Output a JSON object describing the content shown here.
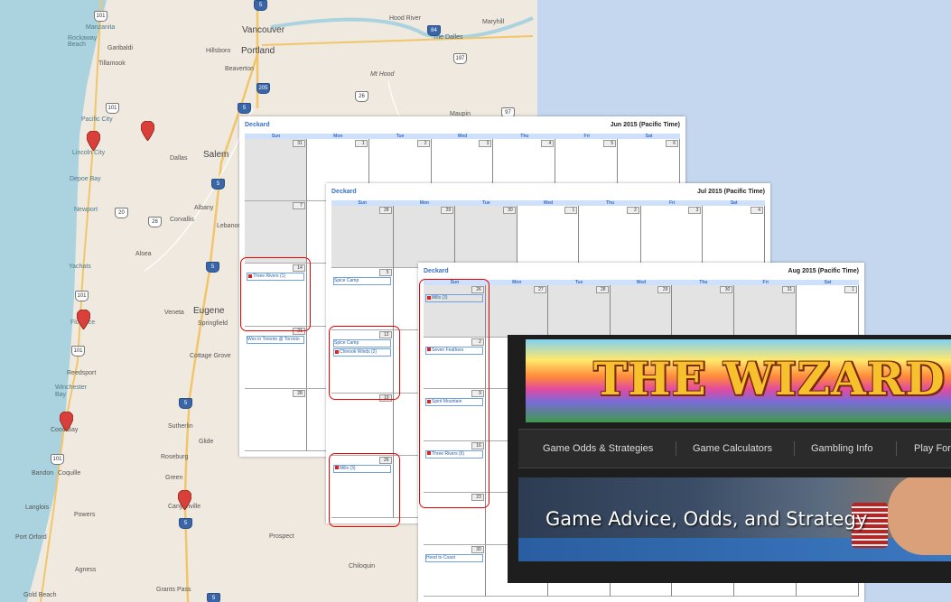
{
  "map": {
    "cities": {
      "vancouver": "Vancouver",
      "portland": "Portland",
      "hillsboro": "Hillsboro",
      "beaverton": "Beaverton",
      "hood_river": "Hood River",
      "maryhill": "Maryhill",
      "the_dalles": "The Dalles",
      "mt_hood": "Mt Hood",
      "maupin": "Maupin",
      "manzanita": "Manzanita",
      "rockaway_beach": "Rockaway Beach",
      "garibaldi": "Garibaldi",
      "tillamook": "Tillamook",
      "pacific_city": "Pacific City",
      "lincoln_city": "Lincoln City",
      "depoe_bay": "Depoe Bay",
      "newport": "Newport",
      "dallas": "Dallas",
      "salem": "Salem",
      "albany": "Albany",
      "corvallis": "Corvallis",
      "lebanon": "Lebanon",
      "alsea": "Alsea",
      "yachats": "Yachats",
      "florence": "Florence",
      "veneta": "Veneta",
      "eugene": "Eugene",
      "springfield": "Springfield",
      "cottage_grove": "Cottage Grove",
      "reedsport": "Reedsport",
      "winchester_bay": "Winchester Bay",
      "coos_bay": "Coos Bay",
      "sutherlin": "Sutherlin",
      "glide": "Glide",
      "roseburg": "Roseburg",
      "green": "Green",
      "bandon": "Bandon",
      "coquille": "Coquille",
      "canyonville": "Canyonville",
      "langlois": "Langlois",
      "powers": "Powers",
      "port_orford": "Port Orford",
      "prospect": "Prospect",
      "agness": "Agness",
      "chiloquin": "Chiloquin",
      "gold_beach": "Gold Beach",
      "grants_pass": "Grants Pass"
    },
    "shields": [
      "101",
      "5",
      "84",
      "197",
      "26",
      "205",
      "5",
      "97",
      "101",
      "20",
      "26",
      "5",
      "101",
      "101",
      "5",
      "101",
      "5",
      "5",
      "5"
    ],
    "colors": {
      "water": "#aad3df",
      "land": "#efe9df",
      "pin": "#d9403a"
    }
  },
  "calendars": {
    "jun": {
      "owner": "Deckard",
      "month": "Jun 2015 (Pacific Time)",
      "days": [
        "Sun",
        "Mon",
        "Tue",
        "Wed",
        "Thu",
        "Fri",
        "Sat"
      ],
      "nums": [
        "31",
        "1",
        "2",
        "3",
        "4",
        "5",
        "6",
        "7",
        "",
        "",
        "",
        "",
        "",
        "",
        "14",
        "",
        "",
        "",
        "",
        "",
        "",
        "21",
        "",
        "",
        "",
        "",
        "",
        "",
        "28",
        "",
        "",
        "",
        "",
        "",
        ""
      ],
      "events": {
        "three_rivers": "Three Rivers (1)",
        "wes": "Wes in Toronto @ Toronto"
      }
    },
    "jul": {
      "owner": "Deckard",
      "month": "Jul 2015 (Pacific Time)",
      "days": [
        "Sun",
        "Mon",
        "Tue",
        "Wed",
        "Thu",
        "Fri",
        "Sat"
      ],
      "nums": [
        "28",
        "29",
        "30",
        "1",
        "2",
        "3",
        "4",
        "5",
        "",
        "",
        "",
        "",
        "",
        "",
        "12",
        "",
        "",
        "",
        "",
        "",
        "",
        "19",
        "",
        "",
        "",
        "",
        "",
        "",
        "26",
        "",
        "",
        "",
        "",
        "",
        ""
      ],
      "events": {
        "spice_camp_1": "Spice Camp",
        "spice_camp_2": "Spice Camp",
        "chinook_winds": "Chinook Winds (2)",
        "mills": "Mills (3)"
      }
    },
    "aug": {
      "owner": "Deckard",
      "month": "Aug 2015 (Pacific Time)",
      "days": [
        "Sun",
        "Mon",
        "Tue",
        "Wed",
        "Thu",
        "Fri",
        "Sat"
      ],
      "nums": [
        "26",
        "27",
        "28",
        "29",
        "30",
        "31",
        "1",
        "2",
        "",
        "",
        "",
        "",
        "",
        "",
        "9",
        "",
        "",
        "",
        "",
        "",
        "",
        "16",
        "",
        "",
        "",
        "",
        "",
        "",
        "23",
        "",
        "",
        "",
        "",
        "",
        "",
        "30",
        "",
        "",
        "",
        "",
        "",
        ""
      ],
      "events": {
        "mills": "Mills (3)",
        "seven_feathers": "Seven Feathers",
        "spirit_mountain": "Spirit Mountain",
        "three_rivers": "Three Rivers (6)",
        "hood_to_coast": "Hood to Coast"
      }
    }
  },
  "wizard": {
    "logo": "THE WIZARD OF ODDS",
    "nav": [
      "Game Odds & Strategies",
      "Game Calculators",
      "Gambling Info",
      "Play For"
    ],
    "hero_title": "Game Advice, Odds, and Strategy"
  }
}
